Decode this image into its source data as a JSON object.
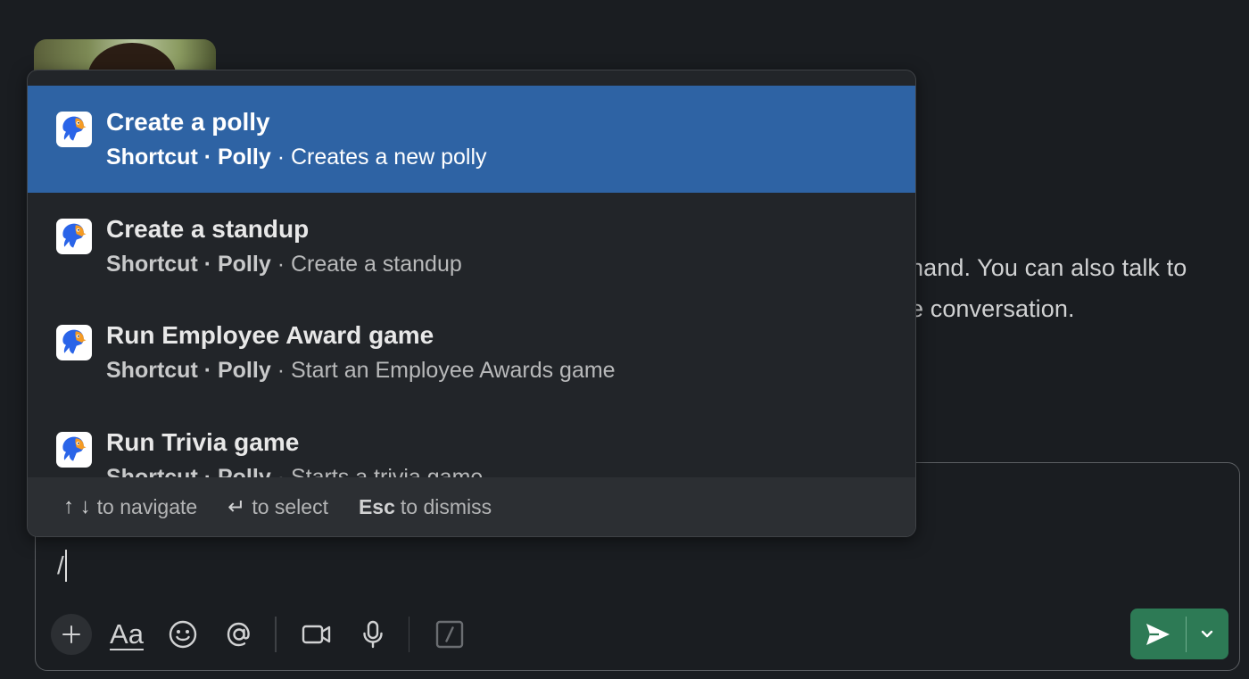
{
  "background_message": {
    "line1": "hand. You can also talk to",
    "line2": "e conversation."
  },
  "autocomplete": {
    "items": [
      {
        "title": "Create a polly",
        "shortcut": "Shortcut · Polly",
        "description": "· Creates a new polly",
        "icon": "polly-app-icon",
        "selected": true
      },
      {
        "title": "Create a standup",
        "shortcut": "Shortcut · Polly",
        "description": "· Create a standup",
        "icon": "polly-app-icon",
        "selected": false
      },
      {
        "title": "Run Employee Award game",
        "shortcut": "Shortcut · Polly",
        "description": "· Start an Employee Awards game",
        "icon": "polly-app-icon",
        "selected": false
      },
      {
        "title": "Run Trivia game",
        "shortcut": "Shortcut · Polly",
        "description": "· Starts a trivia game",
        "icon": "polly-app-icon",
        "selected": false
      }
    ],
    "footer": {
      "navigate_keys": "↑ ↓",
      "navigate_label": "to navigate",
      "select_key": "↵",
      "select_label": "to select",
      "dismiss_key": "Esc",
      "dismiss_label": "to dismiss"
    }
  },
  "composer": {
    "value": "/",
    "toolbar": {
      "format_label": "Aa",
      "icons": [
        "plus-icon",
        "format-icon",
        "emoji-icon",
        "mention-icon",
        "video-icon",
        "microphone-icon",
        "slash-command-icon"
      ]
    },
    "send_color": "#2d7a55"
  },
  "colors": {
    "selected_row": "#2e63a4",
    "popup_bg": "#222529",
    "app_bg": "#1a1d21"
  }
}
